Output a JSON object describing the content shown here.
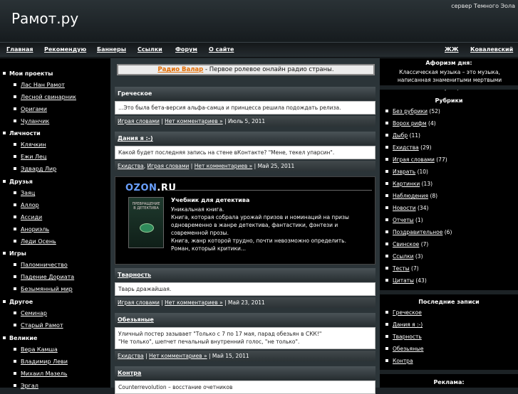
{
  "header": {
    "logo": "Рамот.ру",
    "server": "сервер Темного Эола"
  },
  "nav": {
    "left": [
      "Главная",
      "Рекомендую",
      "Баннеры",
      "Ссылки",
      "Форум",
      "О сайте"
    ],
    "right": [
      "ЖЖ",
      "Ковалевский"
    ]
  },
  "left_sidebar": {
    "sections": [
      {
        "title": "Мои проекты",
        "items": [
          "Лас Нан Рамот",
          "Лесной свинарник",
          "Оригами",
          "Чуланчик"
        ]
      },
      {
        "title": "Личности",
        "items": [
          "Клячкин",
          "Ежи Лец",
          "Эдвард Лир"
        ]
      },
      {
        "title": "Друзья",
        "items": [
          "Заяц",
          "Аллор",
          "Ассиди",
          "Анориэль",
          "Леди Осень"
        ]
      },
      {
        "title": "Игры",
        "items": [
          "Паломничество",
          "Падение Дориата",
          "Безымянный мир"
        ]
      },
      {
        "title": "Другое",
        "items": [
          "Семинар",
          "Старый Рамот"
        ]
      },
      {
        "title": "Великие",
        "items": [
          "Вера Камша",
          "Владимир Леви",
          "Михаил Мазель",
          "Эргал"
        ]
      }
    ]
  },
  "radio": {
    "link": "Радио Валар",
    "text": " - Первое ролевое онлайн радио страны."
  },
  "posts": [
    {
      "title": "Греческое",
      "body": "…Это была бета-версия альфа-самца и принцесса решила подождать релиза.",
      "tags": [
        "Играя словами"
      ],
      "comments": "Нет комментариев »",
      "date": "Июль 5, 2011"
    },
    {
      "title": "Дания я :-)",
      "body": "Какой будет последняя запись на стене вКонтакте? \"Мене, текел упарсин\".",
      "tags": [
        "Ехидства",
        "Играя словами"
      ],
      "comments": "Нет комментариев »",
      "date": "Май 25, 2011"
    },
    {
      "title": "Тварность",
      "body": "Тварь дражайшая.",
      "tags": [
        "Играя словами"
      ],
      "comments": "Нет комментариев »",
      "date": "Май 23, 2011"
    },
    {
      "title": "Обезьяные",
      "body": "Уличный постер зазывает \"Только с 7 по 17 мая, парад обезьян в СКК!\"\n\"Не только\", шепчет печальный внутренний голос, \"не только\".",
      "tags": [
        "Ехидства"
      ],
      "comments": "Нет комментариев »",
      "date": "Май 15, 2011"
    },
    {
      "title": "Контра",
      "body": "Counterrevolution – восстание очетников"
    }
  ],
  "ozon": {
    "logo_main": "OZON",
    "logo_suffix": ".RU",
    "book_cover_text": "ПРЕВРАЩЕНИЕ В ДЕТЕКТИВА",
    "title": "Учебник для детектива",
    "desc": "Уникальная книга.\nКнига, которая собрала урожай призов и номинаций на призы одновременно в жанре детектива, фантастики, фэнтези и современной прозы.\nКнига, жанр которой трудно, почти невозможно определить.\nРоман, который критики..."
  },
  "right_sidebar": {
    "aphorism_head": "Афоризм дня:",
    "aphorism": "Классическая музыка – это музыка, написанная знаменитыми мертвыми иностранцами.",
    "rubrics_head": "Рубрики",
    "rubrics": [
      {
        "name": "Без рубрики",
        "count": "(52)"
      },
      {
        "name": "Ворох рифм",
        "count": "(4)"
      },
      {
        "name": "Дыбр",
        "count": "(11)"
      },
      {
        "name": "Ехидства",
        "count": "(29)"
      },
      {
        "name": "Играя словами",
        "count": "(77)"
      },
      {
        "name": "Изврать",
        "count": "(10)"
      },
      {
        "name": "Картинки",
        "count": "(13)"
      },
      {
        "name": "Наблюдения",
        "count": "(8)"
      },
      {
        "name": "Новости",
        "count": "(34)"
      },
      {
        "name": "Отчеты",
        "count": "(1)"
      },
      {
        "name": "Поздравительное",
        "count": "(6)"
      },
      {
        "name": "Свинское",
        "count": "(7)"
      },
      {
        "name": "Ссылки",
        "count": "(3)"
      },
      {
        "name": "Тесты",
        "count": "(7)"
      },
      {
        "name": "Цитаты",
        "count": "(43)"
      }
    ],
    "recent_head": "Последние записи",
    "recent": [
      "Греческое",
      "Дания я :-)",
      "Тварность",
      "Обезьяные",
      "Контра"
    ],
    "ads_head": "Реклама:"
  }
}
